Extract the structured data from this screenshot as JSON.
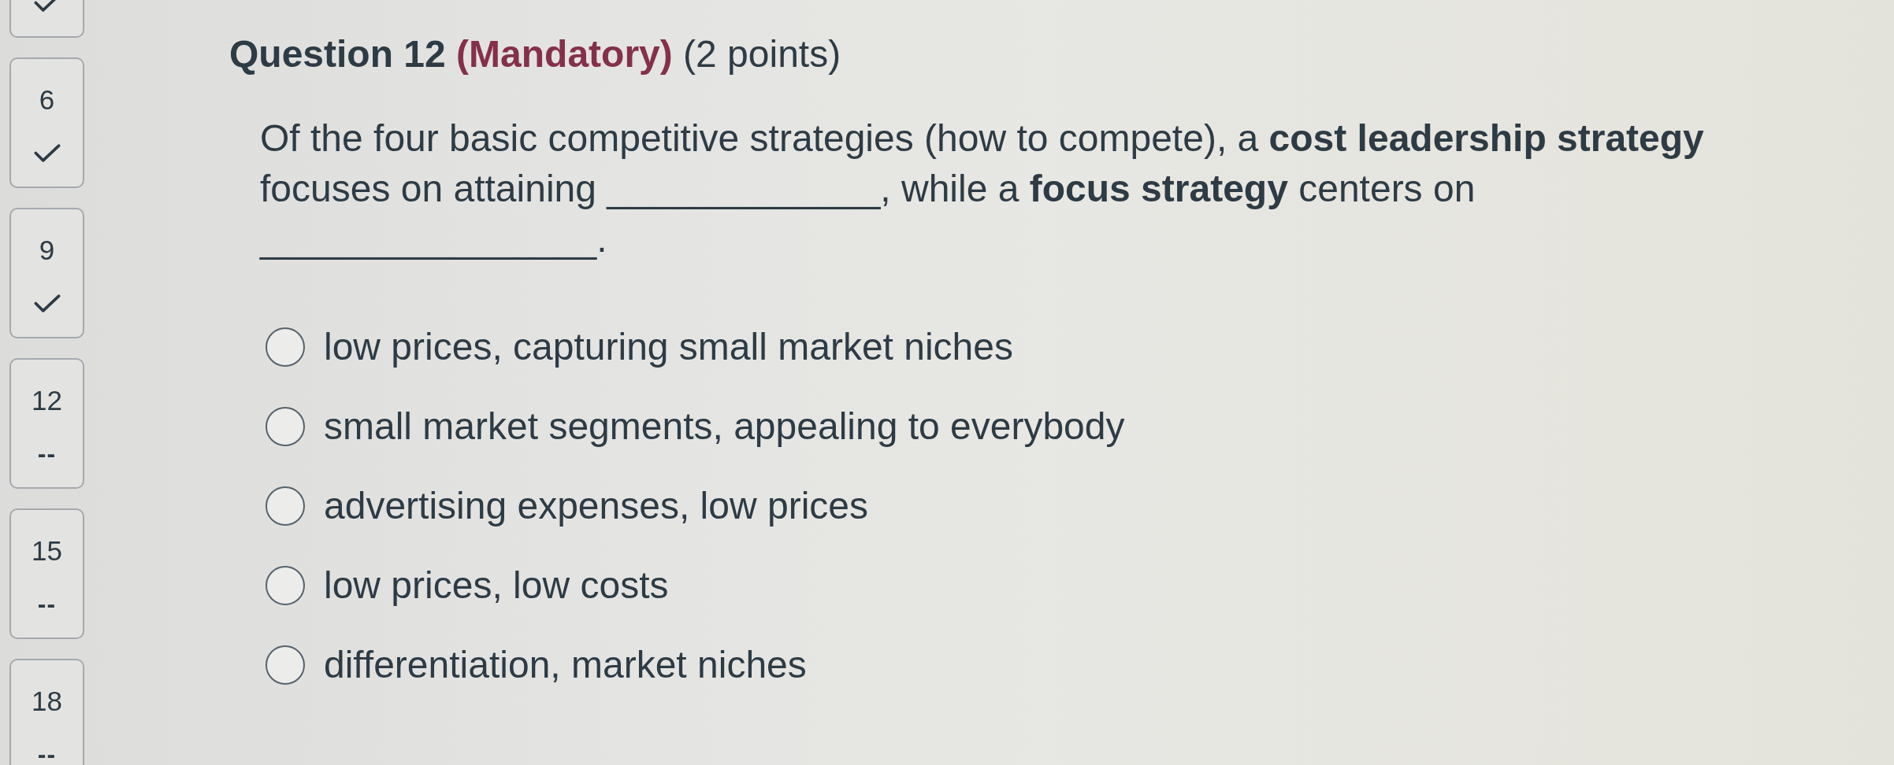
{
  "sidebar": {
    "items": [
      {
        "answered": true
      },
      {
        "number": "6",
        "answered": true
      },
      {
        "number": "9",
        "answered": true
      },
      {
        "number": "12",
        "answered": false,
        "mark": "--"
      },
      {
        "number": "15",
        "answered": false,
        "mark": "--"
      },
      {
        "number": "18",
        "answered": false,
        "mark": "--"
      }
    ]
  },
  "question": {
    "title": "Question 12",
    "flag": "(Mandatory)",
    "points": "(2 points)",
    "text": "Of the four basic competitive strategies (how to compete), a **cost leadership strategy** focuses on attaining _____________, while a **focus strategy** centers on ________________."
  },
  "options": [
    {
      "label": "low prices, capturing small market niches",
      "selected": false
    },
    {
      "label": "small market segments, appealing to everybody",
      "selected": false
    },
    {
      "label": "advertising expenses, low prices",
      "selected": false
    },
    {
      "label": "low prices, low costs",
      "selected": false
    },
    {
      "label": "differentiation, market niches",
      "selected": false
    }
  ]
}
